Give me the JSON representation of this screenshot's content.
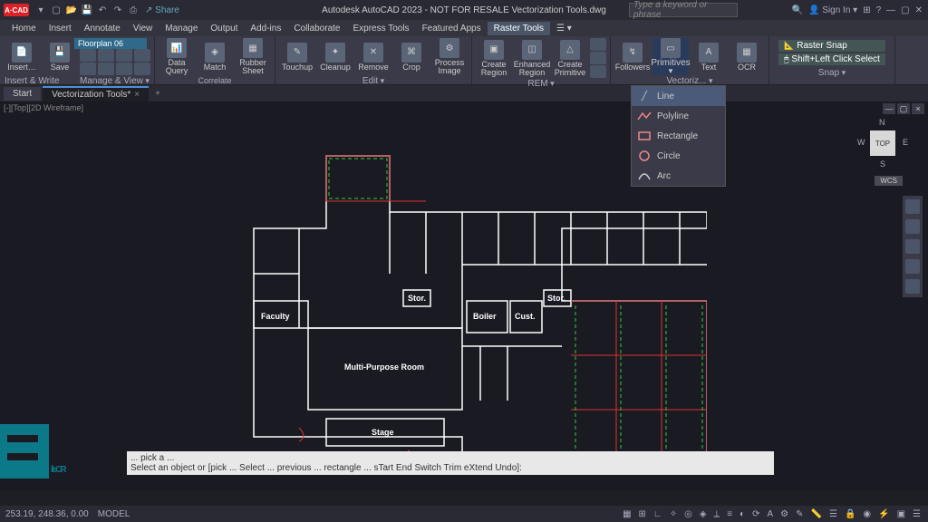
{
  "title": "Autodesk AutoCAD 2023 - NOT FOR RESALE    Vectorization Tools.dwg",
  "share": "Share",
  "search_placeholder": "Type a keyword or phrase",
  "signin": "Sign In",
  "menus": [
    "Home",
    "Insert",
    "Annotate",
    "View",
    "Manage",
    "Output",
    "Add-ins",
    "Collaborate",
    "Express Tools",
    "Featured Apps",
    "Raster Tools"
  ],
  "active_menu": 10,
  "floorplan_combo": "Floorplan 06",
  "panels": {
    "insert_write": {
      "label": "Insert & Write",
      "btns": [
        "Insert…",
        "Save"
      ]
    },
    "manage_view": {
      "label": "Manage & View",
      "btns": [
        "Data Query",
        "Match",
        "Rubber Sheet"
      ]
    },
    "correlate": {
      "label": "Correlate"
    },
    "edit": {
      "label": "Edit",
      "btns": [
        "Touchup",
        "Cleanup",
        "Remove",
        "Crop",
        "Process Image"
      ]
    },
    "rem": {
      "label": "REM",
      "btns": [
        "Create Region",
        "Enhanced Region",
        "Create Primitive"
      ]
    },
    "vectorize": {
      "label": "Vectoriz...",
      "btns": [
        "Followers",
        "Primitives",
        "Text",
        "OCR"
      ]
    },
    "snap": {
      "label": "Snap",
      "raster": "Raster Snap",
      "shift": "Shift+Left Click Select"
    }
  },
  "primitives_menu": [
    "Line",
    "Polyline",
    "Rectangle",
    "Circle",
    "Arc"
  ],
  "doc_tabs": [
    "Start",
    "Vectorization Tools*"
  ],
  "active_tab": 1,
  "vp_label": "[-][Top][2D Wireframe]",
  "viewcube": {
    "face": "TOP",
    "n": "N",
    "s": "S",
    "e": "E",
    "w": "W"
  },
  "wcs": "WCS",
  "rooms": {
    "faculty": "Faculty",
    "multi": "Multi-Purpose Room",
    "stage": "Stage",
    "stor1": "Stor.",
    "boiler": "Boiler",
    "cust": "Cust.",
    "stor2": "Stor."
  },
  "cmdline": {
    "l1": "... pick a ...",
    "l2": "Select an object or [pick ... Select ... previous ... rectangle ... sTart End Switch Trim eXtend Undo]:"
  },
  "status": {
    "coords": "253.19, 248.36, 0.00",
    "model": "MODEL"
  },
  "watermark": "ileCR"
}
